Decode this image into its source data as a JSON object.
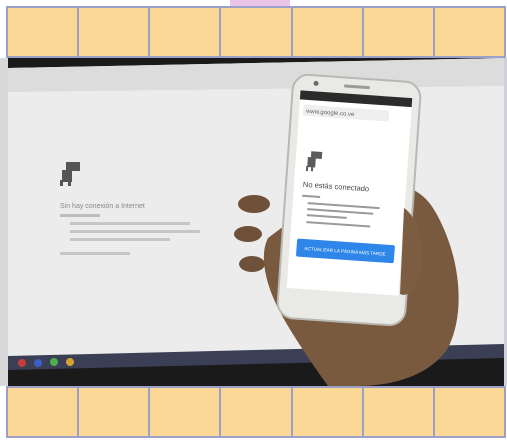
{
  "tiles_top_count": 7,
  "tiles_bottom_count": 7,
  "colors": {
    "tile_fill": "#fbd896",
    "tile_border": "#9aa0c8",
    "accent": "#2e86e8"
  },
  "phone": {
    "url": "www.google.co.ve",
    "heading": "No estás conectado",
    "button": "ACTUALIZAR LA PÁGINA MÁS TARDE"
  },
  "monitor": {
    "heading": "Sin hay conexión a Internet"
  }
}
